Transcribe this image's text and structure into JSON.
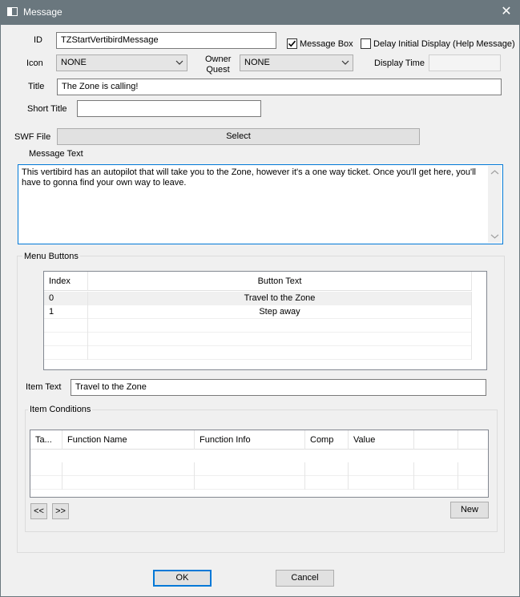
{
  "window": {
    "title": "Message",
    "close_glyph": "✕"
  },
  "form": {
    "id_label": "ID",
    "id_value": "TZStartVertibirdMessage",
    "message_box_label": "Message Box",
    "message_box_checked": true,
    "delay_label": "Delay Initial Display (Help Message)",
    "delay_checked": false,
    "icon_label": "Icon",
    "icon_value": "NONE",
    "owner_quest_label_1": "Owner",
    "owner_quest_label_2": "Quest",
    "owner_quest_value": "NONE",
    "display_time_label": "Display Time",
    "display_time_value": "",
    "title_label": "Title",
    "title_value": "The Zone is calling!",
    "short_title_label": "Short Title",
    "short_title_value": "",
    "swf_label": "SWF File",
    "swf_button": "Select",
    "message_text_label": "Message Text",
    "message_text_value": "This vertibird has an autopilot that will take you to the Zone, however it's a one way ticket. Once you'll get here, you'll have to gonna find your own way to leave."
  },
  "menu_buttons": {
    "group_label": "Menu Buttons",
    "columns": [
      "Index",
      "Button Text"
    ],
    "rows": [
      {
        "index": "0",
        "text": "Travel to the Zone"
      },
      {
        "index": "1",
        "text": "Step away"
      }
    ],
    "item_text_label": "Item Text",
    "item_text_value": "Travel to the Zone"
  },
  "item_conditions": {
    "group_label": "Item Conditions",
    "columns": [
      "Ta...",
      "Function Name",
      "Function Info",
      "Comp",
      "Value",
      "",
      ""
    ],
    "prev_button": "<<",
    "next_button": ">>",
    "new_button": "New"
  },
  "footer": {
    "ok_label": "OK",
    "cancel_label": "Cancel"
  },
  "colors": {
    "titlebar": "#6a777e",
    "focus": "#0078d7",
    "background": "#f0f0f0"
  },
  "icons": {
    "app": "window-icon",
    "close": "close-icon",
    "dropdown": "chevron-down-icon",
    "check": "checkmark-icon"
  }
}
